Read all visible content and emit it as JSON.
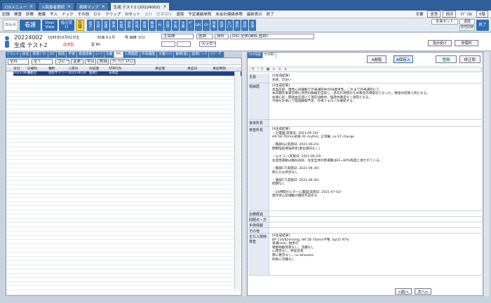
{
  "window_tabs": [
    {
      "label": "CISメニュー",
      "active": false
    },
    {
      "label": "入院患者選択",
      "active": false
    },
    {
      "label": "病棟マップ",
      "active": false
    },
    {
      "label": "生成 テスト2 (20224002)",
      "active": true
    }
  ],
  "menu": [
    "記録",
    "検査",
    "診察",
    "看護",
    "予入",
    "ドック",
    "その他",
    "ＤＶ",
    "クリップ",
    "Ｎセット",
    "会計",
    "医事保存",
    "退院",
    "予定連絡参照",
    "未会計連絡参照",
    "最新表示",
    "終了"
  ],
  "menu_right": {
    "user": "文書",
    "rooms": "居室",
    "doctor": "病床",
    "ward": "ﾒﾃﾞｨｶﾙ",
    "ward_code": "6階"
  },
  "toolbar": {
    "main_buttons": [
      "カルテ",
      "看護",
      "Over View",
      "指示受け",
      "記録"
    ],
    "small_buttons": [
      "処方",
      "注射",
      "処置",
      "検体",
      "生理",
      "放射",
      "内視",
      "病理",
      "輸血",
      "RI",
      "汎用",
      "手術",
      "文書",
      "ﾒﾃﾞｨ",
      "DPC",
      "CP",
      "栄養",
      "指導",
      "ﾘﾊﾋﾞﾘ",
      "歯科",
      "透析",
      "食事"
    ],
    "right_buttons": [
      "外来セット",
      "退院"
    ],
    "right_bottom": "前回記録",
    "exit": "終了"
  },
  "patient": {
    "id": "20224002",
    "name_kana": "セイセイ テスト２",
    "name": "生成 テスト2",
    "dob": "1995年01月01日生",
    "age": "30歳 6ヵ月",
    "ward": "男 病棟 :ICU",
    "blood": "血液型:",
    "rh": "型 Rh",
    "insurance": "主保険",
    "department": "医師",
    "section": "自科",
    "dpc": "DIO 全体(関係 医師)",
    "memo_label": "メッセージ",
    "view_btn1": "指示受け",
    "view_btn2": "管理料"
  },
  "left_tabs": [
    "ﾌﾟﾛﾌｨｰﾙ",
    "病名",
    "患者ﾌﾟﾛﾌ",
    "ｶﾙﾃ",
    "経過",
    "手術",
    "検査結果",
    "ｼｪｰﾏ",
    "文書",
    "ｻﾏﾘ",
    "入院履歴",
    "外来履歴",
    "文書ﾌｧｲﾙ",
    "書類(医)",
    "画像ﾋﾞｭｰｱ",
    "ﾒﾝﾄﾞｰｻﾞ"
  ],
  "left_filter": {
    "f1": "全科",
    "f2": "全て",
    "b1": "コピー",
    "b2": "変更",
    "b3": "中止",
    "b4": "削除",
    "b5": "ｱﾍﾞｲﾗﾌﾞﾙﾁｪﾝｼﾞ"
  },
  "left_columns": [
    "日付",
    "診療科",
    "種別",
    "入院日",
    "作成者",
    "STATUS",
    "承認者",
    "承認日",
    "承認時刻"
  ],
  "left_row": [
    "2021-06-18",
    "総合診",
    "退院サマリー",
    "2021-06-20",
    "医師5",
    "未承認",
    "",
    "",
    ""
  ],
  "right_tabs": [
    "ｻﾏﾘ作成",
    "ｻﾏﾘ(R)"
  ],
  "right_buttons": {
    "a": "A閲覧",
    "b": "A保存入",
    "save": "登録",
    "edit": "修正取"
  },
  "sections": [
    {
      "label": "主訴",
      "text": "[A生成結果]\n先体、のおい"
    },
    {
      "label": "現病歴",
      "text": "[A生成結果]\n高血圧症、慢性心房細動で外来通院中の68歳男性。これまで外来通院にて、\n本日朝外来受診時に突然の胸痛を自覚し、息切れ持続のため救急外来受診となった。精査の結果入院となる。\n右側心房・肺高血圧症にて現在加療中。経過中著変なく退院となる。\n今後も外来にて経過観察予定、外来フォローを継続する。"
    },
    {
      "label": "身体所見",
      "text": ""
    },
    {
      "label": "検査所見",
      "text": "[A生成結果]\n・心電図(実施日: 2021-06-20)\nHR 58-70/min前後 AF rhythm, 正常軸, no ST change\n\n・胸部Xp(実施日: 2021-06-25)\n肺野陰影増強所見(悪化傾向なし)\n\n・心エコー(実施日: 2021-06-20)\n左室壁運動は概ね良好、左室全体の壁運動はEF=60%程度と保たれている。\n\n・胸部CT(実施日: 2021-06-30)\n明らかな所見なし\n\n・頭部CT(実施日: 2021-06-30)\n問題なし\n\n・24時間ホルター心電図(実施日: 2021-07-02)\n発作性心房細動の継続を認める"
    },
    {
      "label": "治療経過",
      "text": ""
    },
    {
      "label": "問題点・方針",
      "text": ""
    },
    {
      "label": "手術情報",
      "text": ""
    },
    {
      "label": "その他",
      "text": ""
    },
    {
      "label": "主な入院時検査",
      "text": "[A生成結果]\nBP 134/82mmHg, HR 58-70/min不整, SpO2 97%\n意識clear, 独歩可\n頸部静脈怒張なし、浮腫なし\n心雑音なし, 呼吸音清\n肺に雑音なし、no wheezes\n四肢に浮腫なし"
    }
  ],
  "pager": {
    "prev": "<前へ",
    "next": "次へ>"
  }
}
